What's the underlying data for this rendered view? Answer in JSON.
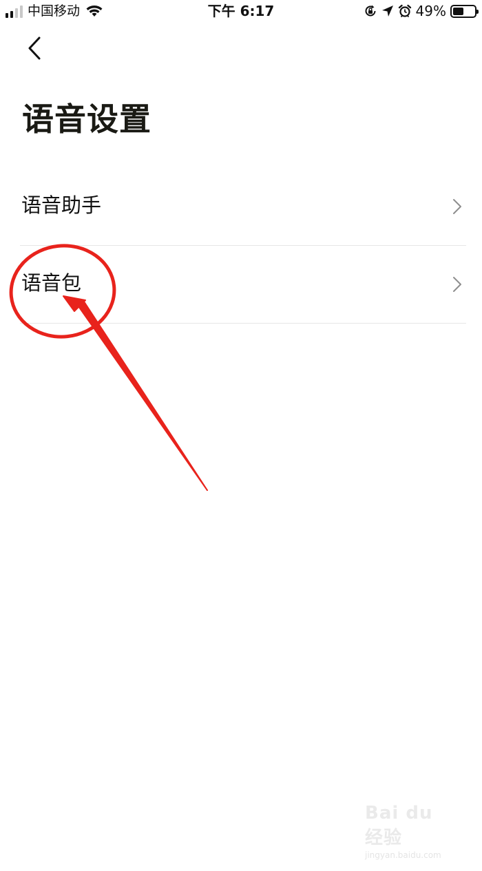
{
  "status_bar": {
    "carrier": "中国移动",
    "time": "下午 6:17",
    "battery_percent": "49%",
    "battery_level": 0.49,
    "signal_bars_total": 4,
    "signal_bars_active": 2,
    "icons": [
      "signal-icon",
      "wifi-icon",
      "orientation-lock-icon",
      "location-arrow-icon",
      "alarm-icon",
      "battery-icon"
    ]
  },
  "nav": {
    "back_icon": "chevron-left-icon"
  },
  "page": {
    "title": "语音设置"
  },
  "settings": {
    "items": [
      {
        "label": "语音助手",
        "icon": "chevron-right-icon"
      },
      {
        "label": "语音包",
        "icon": "chevron-right-icon"
      }
    ]
  },
  "annotation": {
    "color": "#e8231c",
    "shapes": [
      "red-circle-highlight",
      "red-arrow"
    ]
  },
  "watermark": {
    "logo_text": "Bai du 经验",
    "url": "jingyan.baidu.com"
  },
  "colors": {
    "text": "#111111",
    "divider": "#e6e6e6",
    "chevron": "#8e8e8e"
  }
}
